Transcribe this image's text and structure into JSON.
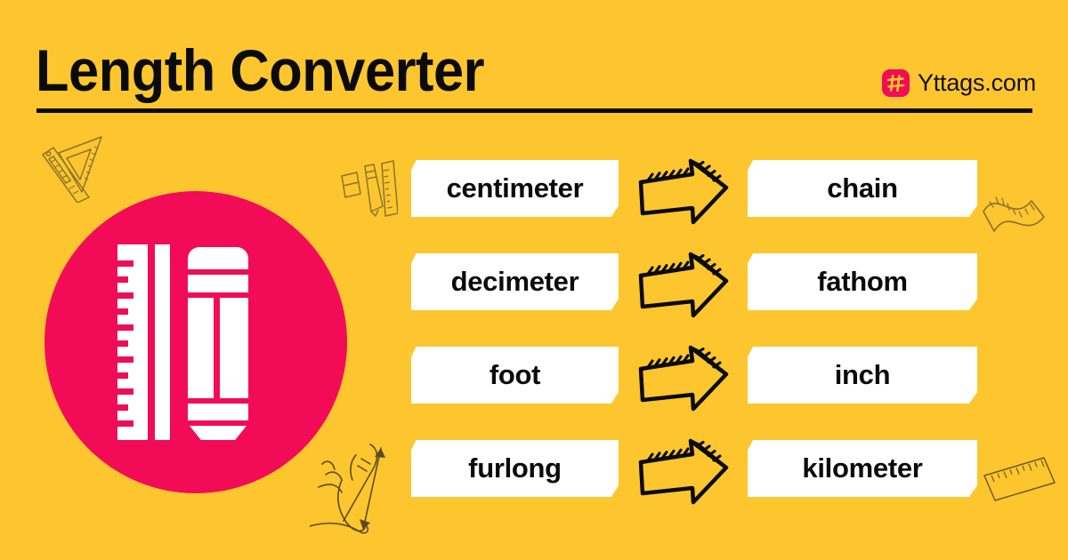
{
  "header": {
    "title": "Length Converter",
    "brand_name": "Yttags.com",
    "brand_logo_icon": "hashtag-icon"
  },
  "badge": {
    "icon": "ruler-and-pencil-icon"
  },
  "colors": {
    "background": "#FDC62E",
    "accent_pink": "#F20B56",
    "chip_background": "#FFFFFF",
    "text": "#0B0B0B",
    "doodle_stroke": "#8A7430"
  },
  "conversions": {
    "arrow_icon": "hand-drawn-right-arrow-icon",
    "rows": [
      {
        "from": "centimeter",
        "to": "chain"
      },
      {
        "from": "decimeter",
        "to": "fathom"
      },
      {
        "from": "foot",
        "to": "inch"
      },
      {
        "from": "furlong",
        "to": "kilometer"
      }
    ]
  },
  "doodles": [
    {
      "name": "ruler-and-set-square-doodle-icon"
    },
    {
      "name": "eraser-pencil-ruler-doodle-icon"
    },
    {
      "name": "flexible-measuring-tape-doodle-icon"
    },
    {
      "name": "hand-measuring-doodle-icon"
    },
    {
      "name": "small-ruler-doodle-icon"
    }
  ]
}
